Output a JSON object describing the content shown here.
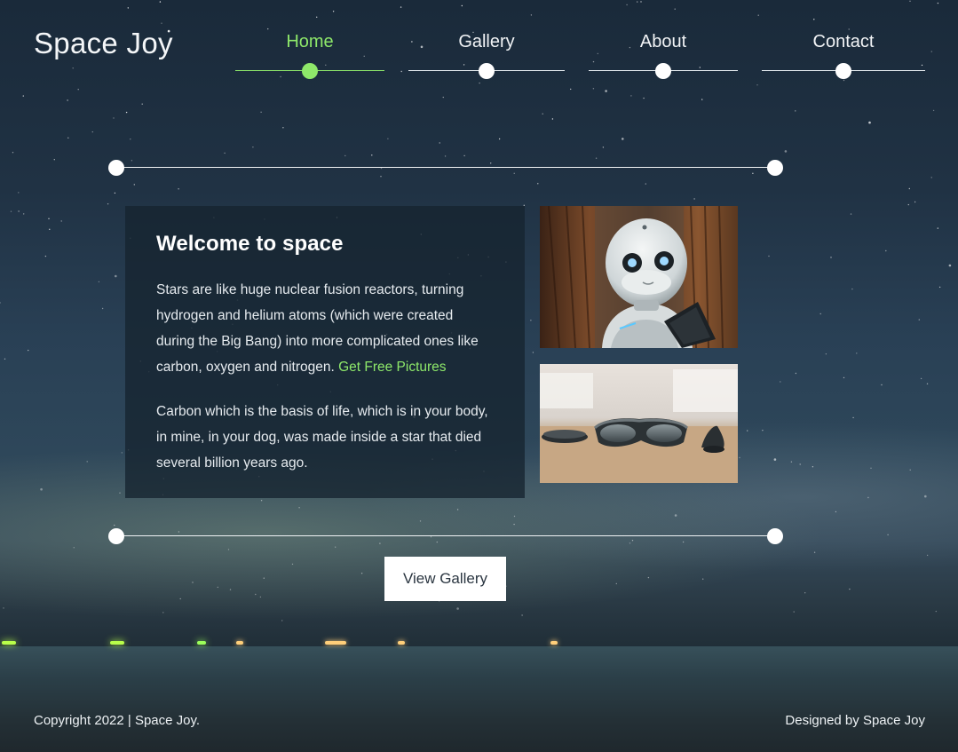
{
  "brand": {
    "name": "Space Joy"
  },
  "nav": {
    "items": [
      {
        "label": "Home",
        "active": true
      },
      {
        "label": "Gallery",
        "active": false
      },
      {
        "label": "About",
        "active": false
      },
      {
        "label": "Contact",
        "active": false
      }
    ]
  },
  "welcome": {
    "heading": "Welcome to space",
    "paragraph1": "Stars are like huge nuclear fusion reactors, turning hydrogen and helium atoms (which were created during the Big Bang) into more complicated ones like carbon, oxygen and nitrogen.",
    "link_label": "Get Free Pictures",
    "paragraph2": "Carbon which is the basis of life, which is in your body, in mine, in your dog, was made inside a star that died several billion years ago."
  },
  "images": [
    {
      "icon": "robot-photo"
    },
    {
      "icon": "vr-glasses-photo"
    }
  ],
  "cta": {
    "label": "View Gallery"
  },
  "footer": {
    "copyright": "Copyright 2022 | Space Joy.",
    "credit": "Designed by Space Joy"
  },
  "colors": {
    "accent": "#8ee86a",
    "panel": "#162430",
    "text": "#ffffff"
  }
}
